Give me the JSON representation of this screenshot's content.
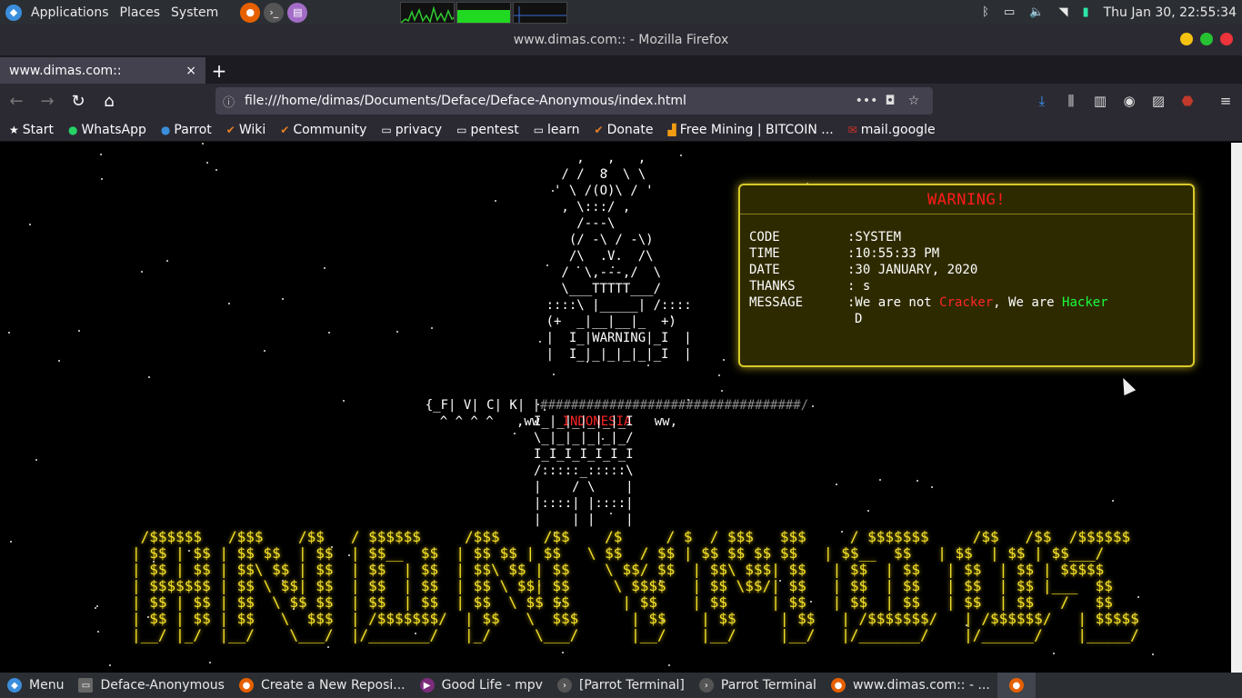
{
  "topbar": {
    "menus": [
      "Applications",
      "Places",
      "System"
    ],
    "launchers": [
      {
        "name": "firefox-launcher-icon",
        "color": "#e66000"
      },
      {
        "name": "terminal-launcher-icon",
        "color": "#555"
      },
      {
        "name": "text-editor-launcher-icon",
        "color": "#a36cc7"
      }
    ],
    "clock": "Thu Jan 30, 22:55:34"
  },
  "window": {
    "title": "www.dimas.com:: - Mozilla Firefox",
    "controls": {
      "minimize": "#f5c211",
      "maximize": "#26c232",
      "close": "#ed333b"
    }
  },
  "tabs": [
    {
      "label": "www.dimas.com::",
      "close": "×"
    }
  ],
  "newtab_label": "+",
  "urlbar": {
    "url": "file:///home/dimas/Documents/Deface/Deface-Anonymous/index.html"
  },
  "bookmarks": [
    {
      "label": "Start",
      "icon": "star-icon"
    },
    {
      "label": "WhatsApp",
      "icon": "whatsapp-icon"
    },
    {
      "label": "Parrot",
      "icon": "parrot-icon"
    },
    {
      "label": "Wiki",
      "icon": "wiki-icon"
    },
    {
      "label": "Community",
      "icon": "community-icon"
    },
    {
      "label": "privacy",
      "icon": "folder-icon"
    },
    {
      "label": "pentest",
      "icon": "folder-icon"
    },
    {
      "label": "learn",
      "icon": "folder-icon"
    },
    {
      "label": "Donate",
      "icon": "donate-icon"
    },
    {
      "label": "Free Mining | BITCOIN ...",
      "icon": "mining-icon"
    },
    {
      "label": "mail.google",
      "icon": "gmail-icon"
    }
  ],
  "page": {
    "ascii_top": "          ,   ,   ,\n        / /  8  \\ \\\n       ' \\ /(O)\\ / '\n        , \\:::/ ,\n          /---\\\n         (/ -\\ / -\\)\n         /\\  .V.  /\\\n        /  \\,---,/  \\\n        \\___TTTTT___/\n      ::::\\ |_____| /::::\n      (+  _|__|__|_  +)\n      |  I_|WARNING|_I  |\n      |  I_|_|_|_|_|_I  |",
    "banner_left": "{_F| V| C| K| |",
    "banner_right": "##################################/",
    "banner_under": "^ ^ ^ ^   ,ww",
    "indonesia": "INDONESIA",
    "banner_ww": "ww,",
    "ascii_legs": "       I_|_|_|_|_|_I\n       \\_|_|_|_|_|_/\n       I_I_I_I_I_I_I\n       /:::::_:::::\\\n       |    / \\    |\n       |::::| |::::|\n       |    | |    |",
    "anonymous_art": " /$$$$$$   /$$$    /$$   / $$$$$$     /$$$     /$$    /$     / $  / $$$   $$$     / $$$$$$$     /$$   /$$  /$$$$$$\n| $$ | $$ | $$ $$  | $$  | $$__  $$  | $$ $$ | $$   \\ $$  / $$ | $$ $$ $$ $$   | $$__  $$   | $$  | $$ | $$___/\n| $$ | $$ | $$\\ $$ | $$  | $$  | $$  | $$\\ $$ | $$    \\ $$/ $$  | $$\\ $$$| $$   | $$  | $$   | $$  | $$ | $$$$$\n| $$$$$$$ | $$ \\ $$| $$  | $$  | $$  | $$ \\ $$| $$     \\ $$$$   | $$ \\$$/| $$   | $$  | $$   | $$  | $$ |___  $$\n| $$ | $$ | $$  \\ $$ $$  | $$  | $$  | $$  \\ $$ $$      | $$    | $$     | $$   | $$  | $$   | $$  | $$   /   $$\n| $$ | $$ | $$   \\  $$$  | /$$$$$$$/  | $$   \\  $$$      | $$    | $$     | $$   | /$$$$$$$/   | /$$$$$$/   | $$$$$\n|__/ |_/  |__/    \\___/  |/_______/   |_/     \\___/      |__/    |__/     |__/   |/_______/    |/______/    |_____/",
    "warning": {
      "title": "WARNING!",
      "rows": [
        {
          "key": "CODE",
          "value": ":SYSTEM"
        },
        {
          "key": "TIME",
          "value": ":10:55:33 PM"
        },
        {
          "key": "DATE",
          "value": ":30 JANUARY, 2020"
        },
        {
          "key": "THANKS",
          "value": ": s"
        }
      ],
      "message_key": "MESSAGE",
      "message_prefix": ":We are not ",
      "message_word1": "Cracker",
      "message_mid": ", We are ",
      "message_word2": "Hacker",
      "message_tail": "D"
    }
  },
  "taskbar": [
    {
      "label": "Menu",
      "icon": "parrot-menu-icon",
      "color": "#3b8edb"
    },
    {
      "label": "Deface-Anonymous",
      "icon": "folder-icon",
      "color": "#666"
    },
    {
      "label": "Create a New Reposi...",
      "icon": "firefox-icon",
      "color": "#e66000"
    },
    {
      "label": "Good Life - mpv",
      "icon": "mpv-icon",
      "color": "#7b2d7b"
    },
    {
      "label": "[Parrot Terminal]",
      "icon": "terminal-icon",
      "color": "#555"
    },
    {
      "label": "Parrot Terminal",
      "icon": "terminal-icon",
      "color": "#555"
    },
    {
      "label": "www.dimas.com:: - ...",
      "icon": "firefox-icon",
      "color": "#e66000"
    }
  ]
}
